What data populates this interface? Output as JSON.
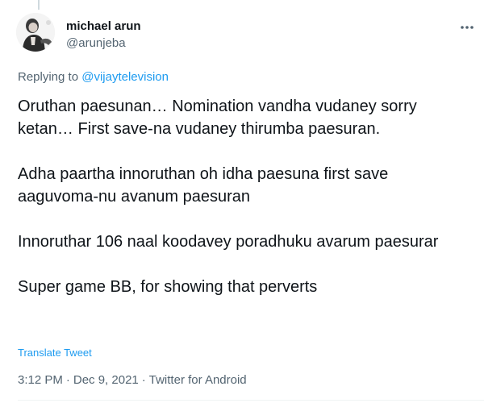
{
  "author": {
    "display_name": "michael arun",
    "handle": "@arunjeba",
    "avatar_icon": "avatar-photo"
  },
  "reply": {
    "prefix": "Replying to ",
    "mention": "@vijaytelevision"
  },
  "tweet": {
    "paragraphs": [
      "Oruthan paesunan… Nomination vandha vudaney sorry ketan… First save-na vudaney thirumba paesuran.",
      "Adha paartha innoruthan oh idha paesuna first save aaguvoma-nu avanum paesuran",
      "Innoruthar 106 naal koodavey poradhuku avarum paesurar",
      "Super game BB, for showing that perverts"
    ],
    "translate_label": "Translate Tweet"
  },
  "meta": {
    "time": "3:12 PM",
    "separator": "·",
    "date": "Dec 9, 2021",
    "source": "Twitter for Android"
  },
  "icons": {
    "more": "more-horizontal-icon"
  },
  "colors": {
    "link": "#1d9bf0",
    "secondary_text": "#536471",
    "primary_text": "#0f1419"
  }
}
